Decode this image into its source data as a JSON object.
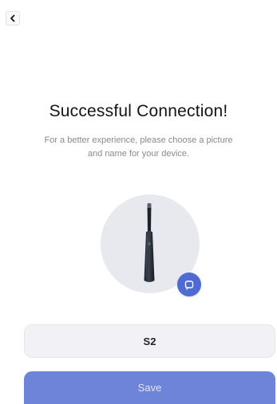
{
  "header": {
    "back_icon": "chevron-left-icon"
  },
  "content": {
    "title": "Successful Connection!",
    "subtitle_line1": "For a better experience, please choose a picture",
    "subtitle_line2": "and name for your device."
  },
  "device": {
    "image": "electric-toothbrush",
    "change_icon": "switch-icon"
  },
  "name_field": {
    "value": "S2"
  },
  "save": {
    "label": "Save"
  },
  "colors": {
    "accent": "#4f6bd3",
    "save_button": "#6e84d8",
    "field_background": "#f2f2f6",
    "circle_background": "#e8e9ee"
  }
}
